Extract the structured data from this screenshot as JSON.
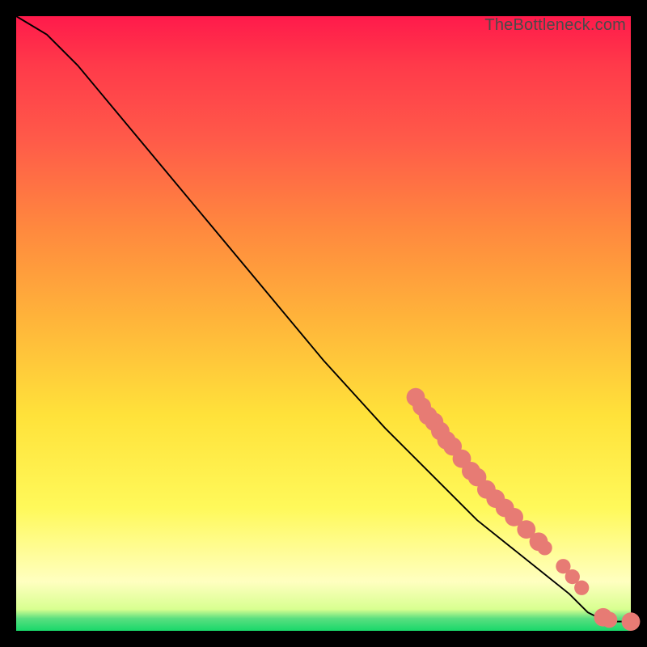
{
  "watermark": "TheBottleneck.com",
  "chart_data": {
    "type": "line",
    "title": "",
    "xlabel": "",
    "ylabel": "",
    "xlim": [
      0,
      100
    ],
    "ylim": [
      0,
      100
    ],
    "curve": [
      {
        "x": 0,
        "y": 100
      },
      {
        "x": 5,
        "y": 97
      },
      {
        "x": 10,
        "y": 92
      },
      {
        "x": 20,
        "y": 80
      },
      {
        "x": 30,
        "y": 68
      },
      {
        "x": 40,
        "y": 56
      },
      {
        "x": 50,
        "y": 44
      },
      {
        "x": 60,
        "y": 33
      },
      {
        "x": 65,
        "y": 28
      },
      {
        "x": 70,
        "y": 23
      },
      {
        "x": 75,
        "y": 18
      },
      {
        "x": 80,
        "y": 14
      },
      {
        "x": 85,
        "y": 10
      },
      {
        "x": 90,
        "y": 6
      },
      {
        "x": 93,
        "y": 3
      },
      {
        "x": 96,
        "y": 1.5
      },
      {
        "x": 100,
        "y": 1.5
      }
    ],
    "markers": [
      {
        "x": 65,
        "y": 38,
        "r": 1.5
      },
      {
        "x": 66,
        "y": 36.5,
        "r": 1.5
      },
      {
        "x": 67,
        "y": 35,
        "r": 1.5
      },
      {
        "x": 68,
        "y": 34,
        "r": 1.5
      },
      {
        "x": 69,
        "y": 32.5,
        "r": 1.5
      },
      {
        "x": 70,
        "y": 31,
        "r": 1.5
      },
      {
        "x": 71,
        "y": 30,
        "r": 1.5
      },
      {
        "x": 72.5,
        "y": 28,
        "r": 1.5
      },
      {
        "x": 74,
        "y": 26,
        "r": 1.5
      },
      {
        "x": 75,
        "y": 25,
        "r": 1.5
      },
      {
        "x": 76.5,
        "y": 23,
        "r": 1.5
      },
      {
        "x": 78,
        "y": 21.5,
        "r": 1.5
      },
      {
        "x": 79.5,
        "y": 20,
        "r": 1.5
      },
      {
        "x": 81,
        "y": 18.5,
        "r": 1.5
      },
      {
        "x": 83,
        "y": 16.5,
        "r": 1.5
      },
      {
        "x": 85,
        "y": 14.5,
        "r": 1.5
      },
      {
        "x": 86,
        "y": 13.5,
        "r": 1.2
      },
      {
        "x": 89,
        "y": 10.5,
        "r": 1.2
      },
      {
        "x": 90.5,
        "y": 8.8,
        "r": 1.2
      },
      {
        "x": 92,
        "y": 7,
        "r": 1.2
      },
      {
        "x": 95.5,
        "y": 2.2,
        "r": 1.5
      },
      {
        "x": 96.5,
        "y": 1.8,
        "r": 1.3
      },
      {
        "x": 100,
        "y": 1.5,
        "r": 1.5
      }
    ],
    "marker_color": "#e77b74",
    "line_color": "#000000"
  }
}
